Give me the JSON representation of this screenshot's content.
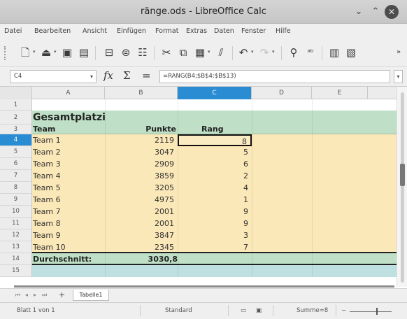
{
  "window": {
    "title": "ränge.ods - LibreOffice Calc"
  },
  "menu": [
    "Datei",
    "Bearbeiten",
    "Ansicht",
    "Einfügen",
    "Format",
    "Extras",
    "Daten",
    "Fenster",
    "Hilfe"
  ],
  "toolbar": {
    "icons": [
      "new-icon",
      "open-icon",
      "save-icon",
      "export-pdf-icon",
      "print-icon",
      "print-preview-icon",
      "cut-icon",
      "copy-icon",
      "paste-icon",
      "clone-formatting-icon",
      "undo-icon",
      "redo-icon",
      "find-replace-icon",
      "spelling-icon",
      "row-icon",
      "column-icon"
    ],
    "more": "»"
  },
  "formula_bar": {
    "name_box": "C4",
    "function_wizard": "fx",
    "sum": "Σ",
    "equals": "=",
    "formula": "=RANG(B4;$B$4:$B$13)"
  },
  "columns": [
    "A",
    "B",
    "C",
    "D",
    "E"
  ],
  "selected_column": "C",
  "selected_row": "4",
  "rows": [
    {
      "n": "1",
      "a": "",
      "b": "",
      "c": ""
    },
    {
      "n": "2",
      "a": "Gesamtplatzierung",
      "b": "",
      "c": ""
    },
    {
      "n": "3",
      "a": "Team",
      "b": "Punkte",
      "c": "Rang"
    },
    {
      "n": "4",
      "a": "Team 1",
      "b": "2119",
      "c": "8"
    },
    {
      "n": "5",
      "a": "Team 2",
      "b": "3047",
      "c": "5"
    },
    {
      "n": "6",
      "a": "Team 3",
      "b": "2909",
      "c": "6"
    },
    {
      "n": "7",
      "a": "Team 4",
      "b": "3859",
      "c": "2"
    },
    {
      "n": "8",
      "a": "Team 5",
      "b": "3205",
      "c": "4"
    },
    {
      "n": "9",
      "a": "Team 6",
      "b": "4975",
      "c": "1"
    },
    {
      "n": "10",
      "a": "Team 7",
      "b": "2001",
      "c": "9"
    },
    {
      "n": "11",
      "a": "Team 8",
      "b": "2001",
      "c": "9"
    },
    {
      "n": "12",
      "a": "Team 9",
      "b": "3847",
      "c": "3"
    },
    {
      "n": "13",
      "a": "Team 10",
      "b": "2345",
      "c": "7"
    },
    {
      "n": "14",
      "a": "Durchschnitt:",
      "b": "3030,8",
      "c": ""
    },
    {
      "n": "15",
      "a": "",
      "b": "",
      "c": ""
    }
  ],
  "colors": {
    "header_band": "#bfe0c6",
    "data_band": "#fbe8b8",
    "summary_band": "#bfe0c6",
    "row15_band": "#bfe0e0",
    "selection": "#2a8dd4"
  },
  "sheet_tab": {
    "label": "Tabelle1",
    "add": "+"
  },
  "status": {
    "sheet": "Blatt 1 von 1",
    "page_style": "Standard",
    "summary": "Summe=8"
  }
}
